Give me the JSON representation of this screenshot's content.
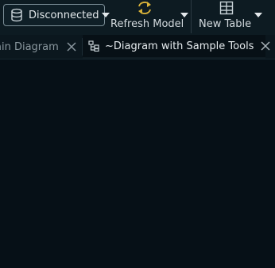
{
  "toolbar": {
    "connection": {
      "label": "Disconnected",
      "icon": "database-icon"
    },
    "refresh": {
      "label": "Refresh Model",
      "icon": "refresh-icon"
    },
    "new_table": {
      "label": "New Table",
      "icon": "table-icon"
    }
  },
  "tabs": [
    {
      "label": "ain Diagram",
      "active": false
    },
    {
      "label": "~Diagram with Sample Tools",
      "active": true,
      "icon": "diagram-icon"
    }
  ],
  "colors": {
    "background": "#071016",
    "toolbar": "#0d1b22",
    "accent_refresh": "#d9b23a",
    "text": "#e3e8eb"
  }
}
